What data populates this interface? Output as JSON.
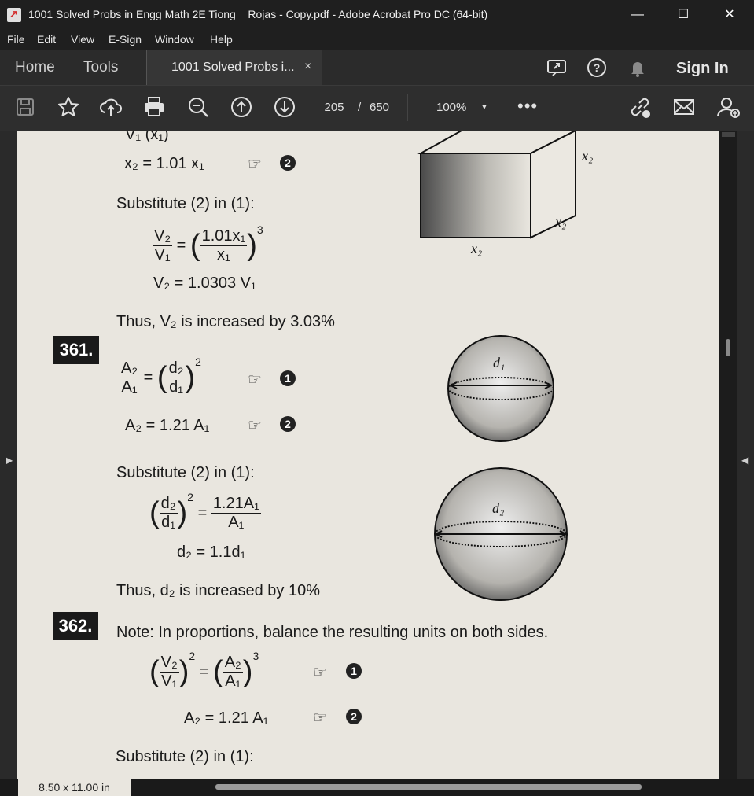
{
  "window": {
    "title": "1001 Solved Probs in Engg Math 2E Tiong _ Rojas - Copy.pdf - Adobe Acrobat Pro DC (64-bit)",
    "minimize": "—",
    "maximize": "☐",
    "close": "✕"
  },
  "menu": [
    "File",
    "Edit",
    "View",
    "E-Sign",
    "Window",
    "Help"
  ],
  "tabs": {
    "home": "Home",
    "tools": "Tools",
    "document": "1001 Solved Probs i...",
    "close": "×"
  },
  "header": {
    "sign_in": "Sign In"
  },
  "toolbar": {
    "page_current": "205",
    "page_sep": "/",
    "page_total": "650",
    "zoom": "100%",
    "zoom_arrow": "▼",
    "more": "•••"
  },
  "status": {
    "page_size": "8.50 x 11.00 in"
  },
  "doc": {
    "top_partial": "V₁    (x₁)",
    "eq_x2": "x₂ = 1.01 x₁",
    "substitute_1": "Substitute (2) in (1):",
    "v_ratio_lhs_n": "V₂",
    "v_ratio_lhs_d": "V₁",
    "v_ratio_rhs_n": "1.01x₁",
    "v_ratio_rhs_d": "x₁",
    "v_ratio_exp": "3",
    "v2_result": "V₂  = 1.0303 V₁",
    "thus_1": "Thus, V₂  is increased by 3.03%",
    "label_x2_a": "x₂",
    "label_x2_b": "x₂",
    "label_x2_c": "x₂",
    "num_361": "361.",
    "a_ratio_n": "A₂",
    "a_ratio_d": "A₁",
    "d_ratio_n": "d₂",
    "d_ratio_d": "d₁",
    "exp_2": "2",
    "a2_eq": "A₂ = 1.21 A₁",
    "substitute_2": "Substitute (2) in (1):",
    "d_ratio2_n": "d₂",
    "d_ratio2_d": "d₁",
    "a_rhs_n": "1.21A₁",
    "a_rhs_d": "A₁",
    "d2_result": "d₂  = 1.1d₁",
    "thus_2": "Thus, d₂ is increased by 10%",
    "label_d1": "d₁",
    "label_d2": "d₂",
    "num_362": "362.",
    "note": "Note: In proportions, balance the resulting units on both sides.",
    "v_ratio3_n": "V₂",
    "v_ratio3_d": "V₁",
    "a_ratio3_n": "A₂",
    "a_ratio3_d": "A₁",
    "exp_3": "3",
    "a2_eq_2": "A₂ = 1.21 A₁",
    "substitute_3": "Substitute (2) in (1):",
    "circled_1": "1",
    "circled_2": "2",
    "equals": "=",
    "hand": "☞"
  },
  "colors": {
    "titlebar": "#1f1f1f",
    "tabbar": "#2b2b2b",
    "toolbar": "#2e2e2e",
    "page": "#e9e6df"
  }
}
